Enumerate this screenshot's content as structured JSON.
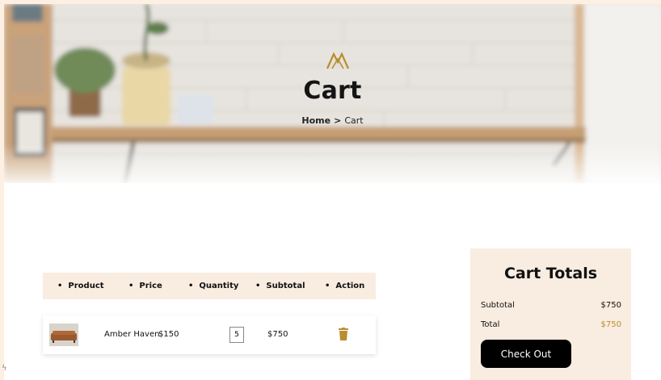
{
  "hero": {
    "title": "Cart"
  },
  "breadcrumb": {
    "home": "Home",
    "separator": ">",
    "current": "Cart"
  },
  "table": {
    "headers": [
      "Product",
      "Price",
      "Quantity",
      "Subtotal",
      "Action"
    ],
    "rows": [
      {
        "name": "Amber Haven",
        "price": "$150",
        "quantity": "5",
        "subtotal": "$750",
        "action_icon": "trash-icon"
      }
    ]
  },
  "totals": {
    "title": "Cart Totals",
    "subtotal_label": "Subtotal",
    "subtotal_value": "$750",
    "total_label": "Total",
    "total_value": "$750",
    "checkout_label": "Check Out"
  },
  "colors": {
    "accent": "#b88e2f",
    "panel": "#f9ece0",
    "page_bg": "#fdf0e2"
  }
}
